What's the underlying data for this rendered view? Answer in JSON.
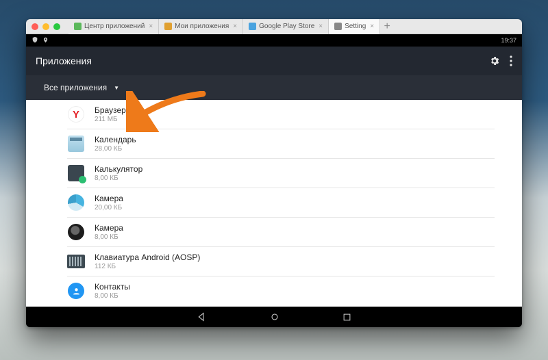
{
  "tabs": [
    {
      "label": "Центр приложений",
      "icon": "#5bb85b"
    },
    {
      "label": "Мои приложения",
      "icon": "#e0a030"
    },
    {
      "label": "Google Play Store",
      "icon": "#4aa3df"
    },
    {
      "label": "Setting",
      "icon": "#888888",
      "active": true
    }
  ],
  "statusbar": {
    "clock": "19:37"
  },
  "header": {
    "title": "Приложения"
  },
  "filter": {
    "label": "Все приложения"
  },
  "apps": [
    {
      "name": "Браузер",
      "size": "211 МБ",
      "icon": "yandex"
    },
    {
      "name": "Календарь",
      "size": "28,00 КБ",
      "icon": "calendar"
    },
    {
      "name": "Калькулятор",
      "size": "8,00 КБ",
      "icon": "calc"
    },
    {
      "name": "Камера",
      "size": "20,00 КБ",
      "icon": "camera-blue"
    },
    {
      "name": "Камера",
      "size": "8,00 КБ",
      "icon": "camera-dark"
    },
    {
      "name": "Клавиатура Android (AOSP)",
      "size": "112 КБ",
      "icon": "keyboard"
    },
    {
      "name": "Контакты",
      "size": "8,00 КБ",
      "icon": "contacts"
    }
  ]
}
